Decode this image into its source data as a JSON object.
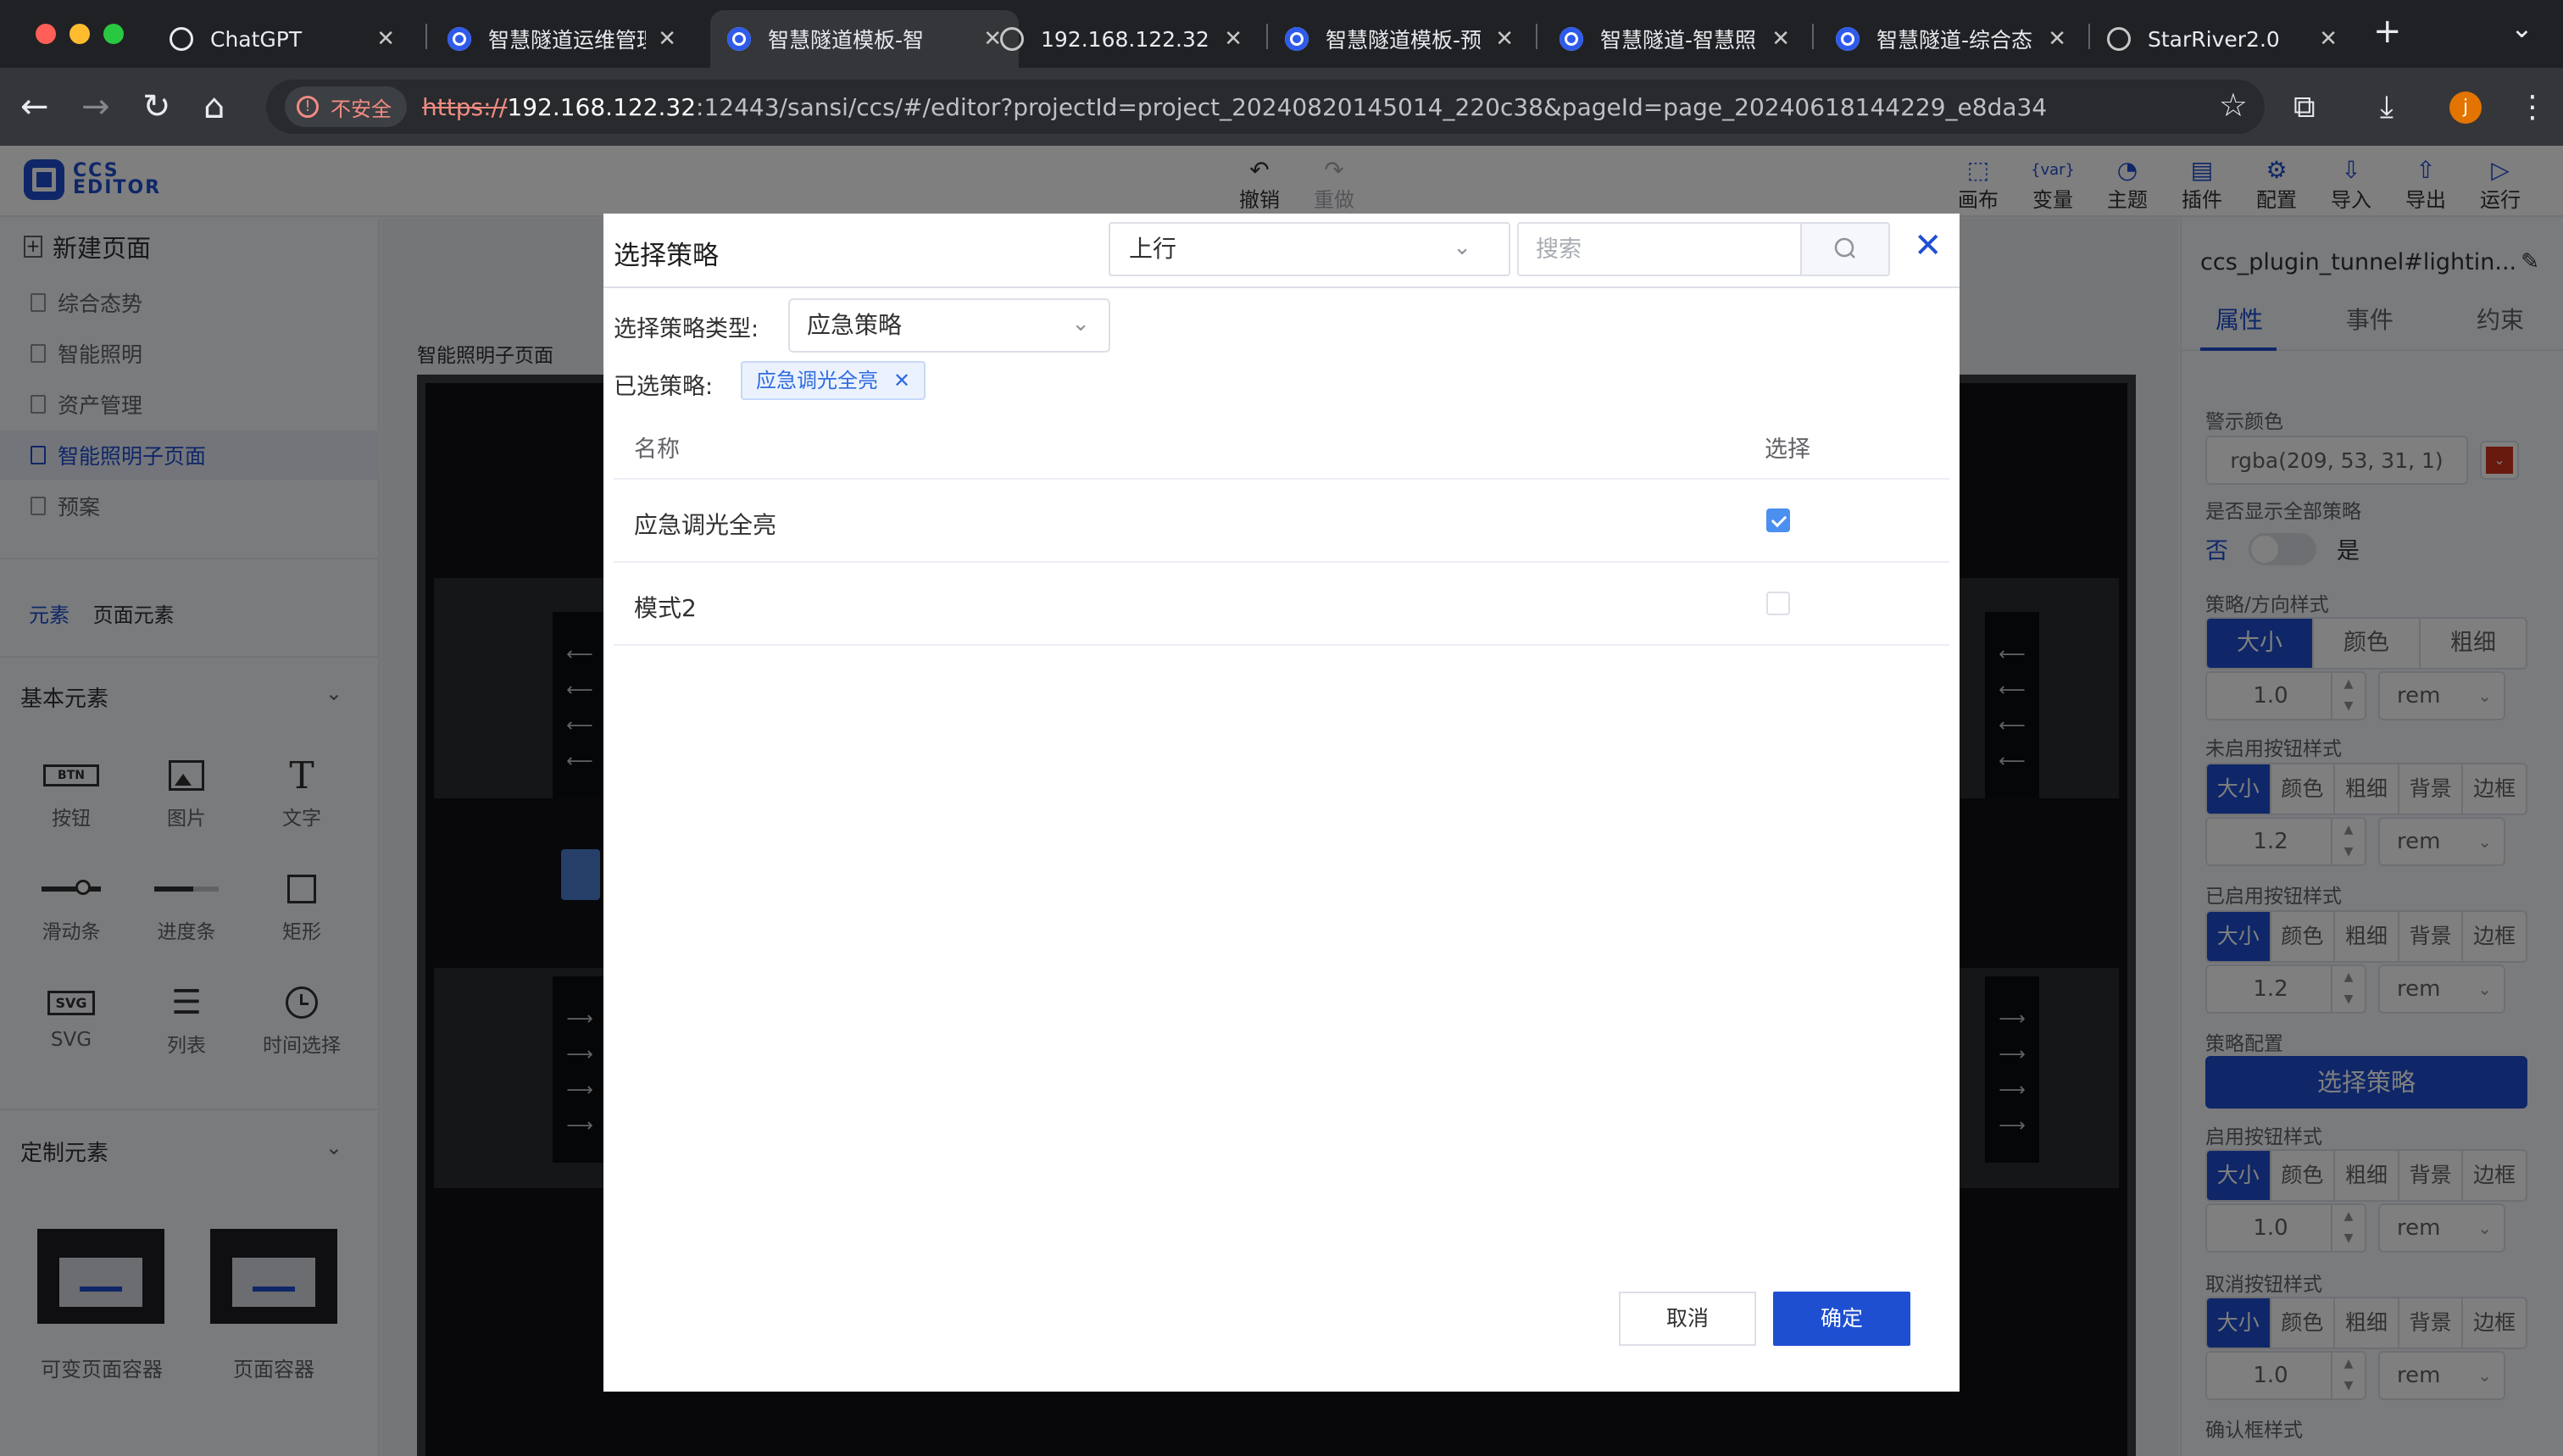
{
  "browser": {
    "tabs": [
      {
        "label": "ChatGPT",
        "icon": "openai-icon"
      },
      {
        "label": "智慧隧道运维管理",
        "icon": "app-icon"
      },
      {
        "label": "智慧隧道模板-智",
        "icon": "app-icon"
      },
      {
        "label": "192.168.122.32",
        "icon": "globe-icon"
      },
      {
        "label": "智慧隧道模板-预",
        "icon": "app-icon"
      },
      {
        "label": "智慧隧道-智慧照",
        "icon": "app-icon"
      },
      {
        "label": "智慧隧道-综合态",
        "icon": "app-icon"
      },
      {
        "label": "StarRiver2.0",
        "icon": "globe-icon"
      }
    ],
    "active_tab_index": 2,
    "security_label": "不安全",
    "url_scheme": "https://",
    "url_host": "192.168.122.32",
    "url_rest": ":12443/sansi/ccs/#/editor?projectId=project_20240820145014_220c38&pageId=page_20240618144229_e8da34",
    "profile_initial": "j",
    "tab_close_glyph": "✕",
    "new_tab_glyph": "+",
    "tab_menu_glyph": "⌄"
  },
  "app": {
    "logo_text_1": "CCS",
    "logo_text_2": "EDITOR",
    "header_actions": {
      "undo": "撤销",
      "redo": "重做",
      "canvas": "画布",
      "variables": "变量",
      "variables_icon": "{var}",
      "theme": "主题",
      "plugins": "插件",
      "config": "配置",
      "import": "导入",
      "export": "导出",
      "run": "运行"
    }
  },
  "left_panel": {
    "new_page": "新建页面",
    "pages": [
      "综合态势",
      "智能照明",
      "资产管理",
      "智能照明子页面",
      "预案"
    ],
    "active_page_index": 3,
    "tabs": [
      "元素",
      "页面元素"
    ],
    "basic_section": "基本元素",
    "basic_elements": [
      {
        "label": "按钮",
        "icon": "button-icon",
        "glyph": "BTN"
      },
      {
        "label": "图片",
        "icon": "image-icon",
        "glyph": ""
      },
      {
        "label": "文字",
        "icon": "text-icon",
        "glyph": "T"
      },
      {
        "label": "滑动条",
        "icon": "slider-icon",
        "glyph": ""
      },
      {
        "label": "进度条",
        "icon": "progress-icon",
        "glyph": ""
      },
      {
        "label": "矩形",
        "icon": "rectangle-icon",
        "glyph": ""
      },
      {
        "label": "SVG",
        "icon": "svg-icon",
        "glyph": "SVG"
      },
      {
        "label": "列表",
        "icon": "list-icon",
        "glyph": ""
      },
      {
        "label": "时间选择",
        "icon": "clock-icon",
        "glyph": ""
      }
    ],
    "custom_section": "定制元素",
    "custom_elements": [
      "可变页面容器",
      "页面容器"
    ]
  },
  "canvas": {
    "title": "智能照明子页面"
  },
  "right_panel": {
    "title": "ccs_plugin_tunnel#lightin...",
    "tabs": [
      "属性",
      "事件",
      "约束"
    ],
    "warning_color_label": "警示颜色",
    "warning_color_value": "rgba(209, 53, 31, 1)",
    "warning_color": "#d1351f",
    "show_all_label": "是否显示全部策略",
    "toggle_off": "否",
    "toggle_on": "是",
    "strategy_dir_style_label": "策略/方向样式",
    "strategy_dir_style_options": [
      "大小",
      "颜色",
      "粗细"
    ],
    "size1": "1.0",
    "unit": "rem",
    "disabled_btn_label": "未启用按钮样式",
    "style_options": [
      "大小",
      "颜色",
      "粗细",
      "背景",
      "边框"
    ],
    "size2": "1.2",
    "enabled_btn_label": "已启用按钮样式",
    "size3": "1.2",
    "strategy_config_label": "策略配置",
    "choose_strategy_button": "选择策略",
    "enable_btn_label": "启用按钮样式",
    "size4": "1.0",
    "cancel_btn_label": "取消按钮样式",
    "size5": "1.0",
    "confirm_box_label": "确认框样式"
  },
  "dialog": {
    "title": "选择策略",
    "direction_value": "上行",
    "search_placeholder": "搜索",
    "type_label": "选择策略类型:",
    "type_value": "应急策略",
    "selected_label": "已选策略:",
    "selected_chips": [
      "应急调光全亮"
    ],
    "columns": [
      "名称",
      "选择"
    ],
    "rows": [
      {
        "name": "应急调光全亮",
        "checked": true
      },
      {
        "name": "模式2",
        "checked": false
      }
    ],
    "cancel": "取消",
    "confirm": "确定",
    "close_glyph": "✕"
  },
  "colors": {
    "primary": "#1f4fd1",
    "chrome_bg": "#202124"
  }
}
